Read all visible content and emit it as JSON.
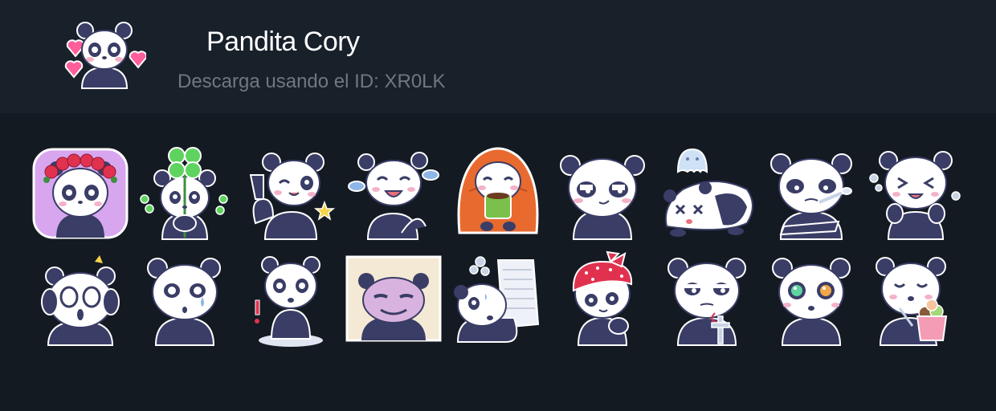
{
  "pack": {
    "title": "Pandita Cory",
    "subtitle": "Descarga usando el ID: XR0LK",
    "cover": "panda-hearts"
  },
  "colors": {
    "header_bg": "#18202a",
    "page_bg": "#141a22",
    "panda_dark": "#3a3d66",
    "panda_light": "#ffffff",
    "blush": "#f3b2c9"
  },
  "stickers": [
    [
      "panda-rose-crown",
      "panda-clover",
      "panda-wink-peace",
      "panda-laugh-tears",
      "panda-blanket-tea",
      "panda-smirk",
      "panda-ghost-ko",
      "panda-grumpy-spoon",
      "panda-giggle"
    ],
    [
      "panda-shocked-facepalm",
      "panda-sad-tear",
      "panda-alarmed",
      "panda-framed-smug",
      "panda-paper-stack",
      "panda-red-bandana",
      "panda-suspicious-cross",
      "panda-starry-eyes",
      "panda-ice-cream"
    ]
  ]
}
